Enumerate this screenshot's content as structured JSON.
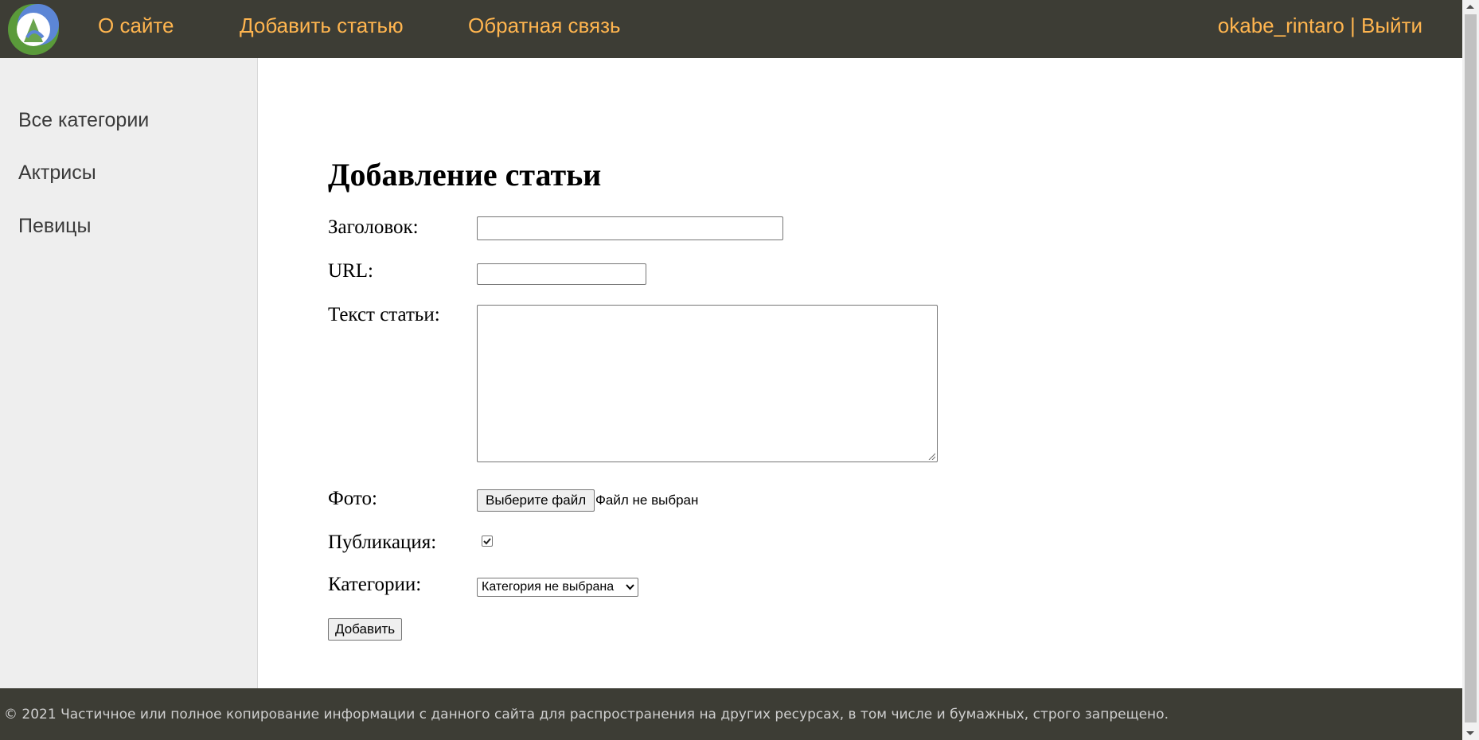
{
  "nav": {
    "logo_icon": "site-logo-icon",
    "links": [
      "О сайте",
      "Добавить статью",
      "Обратная связь"
    ],
    "username": "okabe_rintaro",
    "separator": "|",
    "logout": "Выйти"
  },
  "sidebar": {
    "items": [
      "Все категории",
      "Актрисы",
      "Певицы"
    ]
  },
  "form": {
    "title": "Добавление статьи",
    "title_label": "Заголовок:",
    "title_value": "",
    "url_label": "URL:",
    "url_value": "",
    "content_label": "Текст статьи:",
    "content_value": "",
    "photo_label": "Фото:",
    "photo_button": "Выберите файл",
    "photo_status": "Файл не выбран",
    "publish_label": "Публикация:",
    "publish_checked": true,
    "category_label": "Категории:",
    "category_selected": "Категория не выбрана",
    "submit": "Добавить"
  },
  "footer": {
    "text": "© 2021 Частичное или полное копирование информации с данного сайта для распространения на других ресурсах, в том числе и бумажных, строго запрещено."
  },
  "colors": {
    "header_bg": "#3d3d35",
    "nav_link": "#ffb54f",
    "sidebar_bg": "#eeeeee",
    "footer_text": "#cfcfcf"
  }
}
